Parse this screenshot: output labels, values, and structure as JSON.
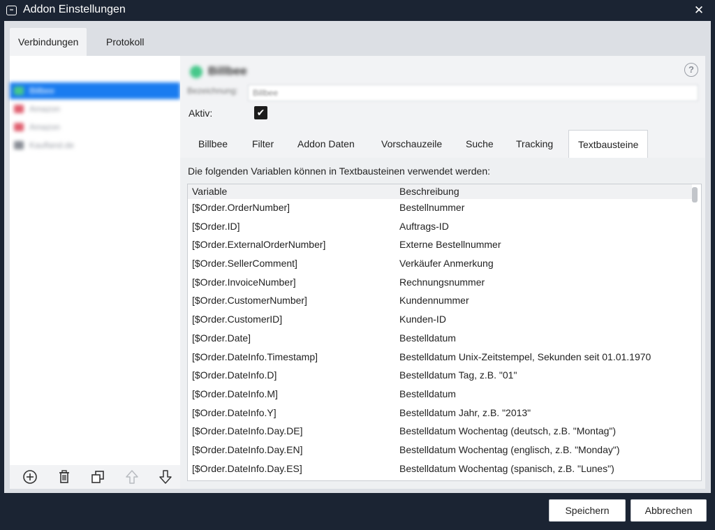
{
  "window": {
    "title": "Addon Einstellungen",
    "app_icon_text": "∞",
    "close_glyph": "✕"
  },
  "top_tabs": [
    {
      "label": "Verbindungen",
      "active": true
    },
    {
      "label": "Protokoll",
      "active": false
    }
  ],
  "sidebar": {
    "items": [
      {
        "label": "Billbee",
        "icon_color": "#46c88a",
        "selected": true
      },
      {
        "label": "Amazon",
        "icon_color": "#e06070",
        "selected": false
      },
      {
        "label": "Amazon",
        "icon_color": "#e06070",
        "selected": false
      },
      {
        "label": "Kaufland.de",
        "icon_color": "#8a8e96",
        "selected": false
      }
    ],
    "selection_color": "#1a7cf0",
    "toolbar_icons": [
      "add-icon",
      "trash-icon",
      "duplicate-icon",
      "arrow-up-icon",
      "arrow-down-icon"
    ]
  },
  "detail": {
    "connection_name": "Billbee",
    "name_label": "Bezeichnung:",
    "name_value": "Billbee",
    "active_label": "Aktiv:",
    "active_checked": true,
    "help_glyph": "?",
    "check_glyph": "✔",
    "sub_tabs": [
      {
        "label": "Billbee",
        "active": false
      },
      {
        "label": "Filter",
        "active": false
      },
      {
        "label": "Addon Daten",
        "active": false
      },
      {
        "label": "Vorschauzeile",
        "active": false
      },
      {
        "label": "Suche",
        "active": false
      },
      {
        "label": "Tracking",
        "active": false
      },
      {
        "label": "Textbausteine",
        "active": true
      }
    ]
  },
  "textbausteine": {
    "intro": "Die folgenden Variablen können in Textbausteinen verwendet werden:",
    "columns": {
      "variable": "Variable",
      "description": "Beschreibung"
    },
    "rows": [
      {
        "variable": "[$Order.OrderNumber]",
        "description": "Bestellnummer"
      },
      {
        "variable": "[$Order.ID]",
        "description": "Auftrags-ID"
      },
      {
        "variable": "[$Order.ExternalOrderNumber]",
        "description": "Externe Bestellnummer"
      },
      {
        "variable": "[$Order.SellerComment]",
        "description": "Verkäufer Anmerkung"
      },
      {
        "variable": "[$Order.InvoiceNumber]",
        "description": "Rechnungsnummer"
      },
      {
        "variable": "[$Order.CustomerNumber]",
        "description": "Kundennummer"
      },
      {
        "variable": "[$Order.CustomerID]",
        "description": "Kunden-ID"
      },
      {
        "variable": "[$Order.Date]",
        "description": "Bestelldatum"
      },
      {
        "variable": "[$Order.DateInfo.Timestamp]",
        "description": "Bestelldatum Unix-Zeitstempel, Sekunden seit 01.01.1970"
      },
      {
        "variable": "[$Order.DateInfo.D]",
        "description": "Bestelldatum Tag, z.B. \"01\""
      },
      {
        "variable": "[$Order.DateInfo.M]",
        "description": "Bestelldatum"
      },
      {
        "variable": "[$Order.DateInfo.Y]",
        "description": "Bestelldatum Jahr, z.B. \"2013\""
      },
      {
        "variable": "[$Order.DateInfo.Day.DE]",
        "description": "Bestelldatum Wochentag (deutsch, z.B. \"Montag\")"
      },
      {
        "variable": "[$Order.DateInfo.Day.EN]",
        "description": "Bestelldatum Wochentag (englisch, z.B. \"Monday\")"
      },
      {
        "variable": "[$Order.DateInfo.Day.ES]",
        "description": "Bestelldatum Wochentag (spanisch, z.B. \"Lunes\")"
      }
    ]
  },
  "footer": {
    "save_label": "Speichern",
    "cancel_label": "Abbrechen"
  }
}
